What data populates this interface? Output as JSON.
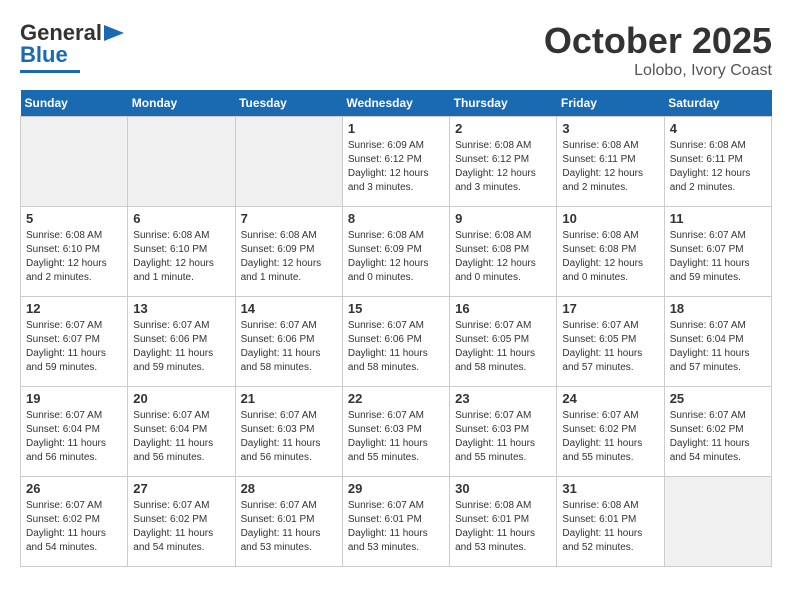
{
  "logo": {
    "line1": "General",
    "line2": "Blue"
  },
  "title": "October 2025",
  "location": "Lolobo, Ivory Coast",
  "weekdays": [
    "Sunday",
    "Monday",
    "Tuesday",
    "Wednesday",
    "Thursday",
    "Friday",
    "Saturday"
  ],
  "weeks": [
    [
      {
        "day": "",
        "empty": true
      },
      {
        "day": "",
        "empty": true
      },
      {
        "day": "",
        "empty": true
      },
      {
        "day": "1",
        "sunrise": "Sunrise: 6:09 AM",
        "sunset": "Sunset: 6:12 PM",
        "daylight": "Daylight: 12 hours and 3 minutes."
      },
      {
        "day": "2",
        "sunrise": "Sunrise: 6:08 AM",
        "sunset": "Sunset: 6:12 PM",
        "daylight": "Daylight: 12 hours and 3 minutes."
      },
      {
        "day": "3",
        "sunrise": "Sunrise: 6:08 AM",
        "sunset": "Sunset: 6:11 PM",
        "daylight": "Daylight: 12 hours and 2 minutes."
      },
      {
        "day": "4",
        "sunrise": "Sunrise: 6:08 AM",
        "sunset": "Sunset: 6:11 PM",
        "daylight": "Daylight: 12 hours and 2 minutes."
      }
    ],
    [
      {
        "day": "5",
        "sunrise": "Sunrise: 6:08 AM",
        "sunset": "Sunset: 6:10 PM",
        "daylight": "Daylight: 12 hours and 2 minutes."
      },
      {
        "day": "6",
        "sunrise": "Sunrise: 6:08 AM",
        "sunset": "Sunset: 6:10 PM",
        "daylight": "Daylight: 12 hours and 1 minute."
      },
      {
        "day": "7",
        "sunrise": "Sunrise: 6:08 AM",
        "sunset": "Sunset: 6:09 PM",
        "daylight": "Daylight: 12 hours and 1 minute."
      },
      {
        "day": "8",
        "sunrise": "Sunrise: 6:08 AM",
        "sunset": "Sunset: 6:09 PM",
        "daylight": "Daylight: 12 hours and 0 minutes."
      },
      {
        "day": "9",
        "sunrise": "Sunrise: 6:08 AM",
        "sunset": "Sunset: 6:08 PM",
        "daylight": "Daylight: 12 hours and 0 minutes."
      },
      {
        "day": "10",
        "sunrise": "Sunrise: 6:08 AM",
        "sunset": "Sunset: 6:08 PM",
        "daylight": "Daylight: 12 hours and 0 minutes."
      },
      {
        "day": "11",
        "sunrise": "Sunrise: 6:07 AM",
        "sunset": "Sunset: 6:07 PM",
        "daylight": "Daylight: 11 hours and 59 minutes."
      }
    ],
    [
      {
        "day": "12",
        "sunrise": "Sunrise: 6:07 AM",
        "sunset": "Sunset: 6:07 PM",
        "daylight": "Daylight: 11 hours and 59 minutes."
      },
      {
        "day": "13",
        "sunrise": "Sunrise: 6:07 AM",
        "sunset": "Sunset: 6:06 PM",
        "daylight": "Daylight: 11 hours and 59 minutes."
      },
      {
        "day": "14",
        "sunrise": "Sunrise: 6:07 AM",
        "sunset": "Sunset: 6:06 PM",
        "daylight": "Daylight: 11 hours and 58 minutes."
      },
      {
        "day": "15",
        "sunrise": "Sunrise: 6:07 AM",
        "sunset": "Sunset: 6:06 PM",
        "daylight": "Daylight: 11 hours and 58 minutes."
      },
      {
        "day": "16",
        "sunrise": "Sunrise: 6:07 AM",
        "sunset": "Sunset: 6:05 PM",
        "daylight": "Daylight: 11 hours and 58 minutes."
      },
      {
        "day": "17",
        "sunrise": "Sunrise: 6:07 AM",
        "sunset": "Sunset: 6:05 PM",
        "daylight": "Daylight: 11 hours and 57 minutes."
      },
      {
        "day": "18",
        "sunrise": "Sunrise: 6:07 AM",
        "sunset": "Sunset: 6:04 PM",
        "daylight": "Daylight: 11 hours and 57 minutes."
      }
    ],
    [
      {
        "day": "19",
        "sunrise": "Sunrise: 6:07 AM",
        "sunset": "Sunset: 6:04 PM",
        "daylight": "Daylight: 11 hours and 56 minutes."
      },
      {
        "day": "20",
        "sunrise": "Sunrise: 6:07 AM",
        "sunset": "Sunset: 6:04 PM",
        "daylight": "Daylight: 11 hours and 56 minutes."
      },
      {
        "day": "21",
        "sunrise": "Sunrise: 6:07 AM",
        "sunset": "Sunset: 6:03 PM",
        "daylight": "Daylight: 11 hours and 56 minutes."
      },
      {
        "day": "22",
        "sunrise": "Sunrise: 6:07 AM",
        "sunset": "Sunset: 6:03 PM",
        "daylight": "Daylight: 11 hours and 55 minutes."
      },
      {
        "day": "23",
        "sunrise": "Sunrise: 6:07 AM",
        "sunset": "Sunset: 6:03 PM",
        "daylight": "Daylight: 11 hours and 55 minutes."
      },
      {
        "day": "24",
        "sunrise": "Sunrise: 6:07 AM",
        "sunset": "Sunset: 6:02 PM",
        "daylight": "Daylight: 11 hours and 55 minutes."
      },
      {
        "day": "25",
        "sunrise": "Sunrise: 6:07 AM",
        "sunset": "Sunset: 6:02 PM",
        "daylight": "Daylight: 11 hours and 54 minutes."
      }
    ],
    [
      {
        "day": "26",
        "sunrise": "Sunrise: 6:07 AM",
        "sunset": "Sunset: 6:02 PM",
        "daylight": "Daylight: 11 hours and 54 minutes."
      },
      {
        "day": "27",
        "sunrise": "Sunrise: 6:07 AM",
        "sunset": "Sunset: 6:02 PM",
        "daylight": "Daylight: 11 hours and 54 minutes."
      },
      {
        "day": "28",
        "sunrise": "Sunrise: 6:07 AM",
        "sunset": "Sunset: 6:01 PM",
        "daylight": "Daylight: 11 hours and 53 minutes."
      },
      {
        "day": "29",
        "sunrise": "Sunrise: 6:07 AM",
        "sunset": "Sunset: 6:01 PM",
        "daylight": "Daylight: 11 hours and 53 minutes."
      },
      {
        "day": "30",
        "sunrise": "Sunrise: 6:08 AM",
        "sunset": "Sunset: 6:01 PM",
        "daylight": "Daylight: 11 hours and 53 minutes."
      },
      {
        "day": "31",
        "sunrise": "Sunrise: 6:08 AM",
        "sunset": "Sunset: 6:01 PM",
        "daylight": "Daylight: 11 hours and 52 minutes."
      },
      {
        "day": "",
        "empty": true
      }
    ]
  ]
}
